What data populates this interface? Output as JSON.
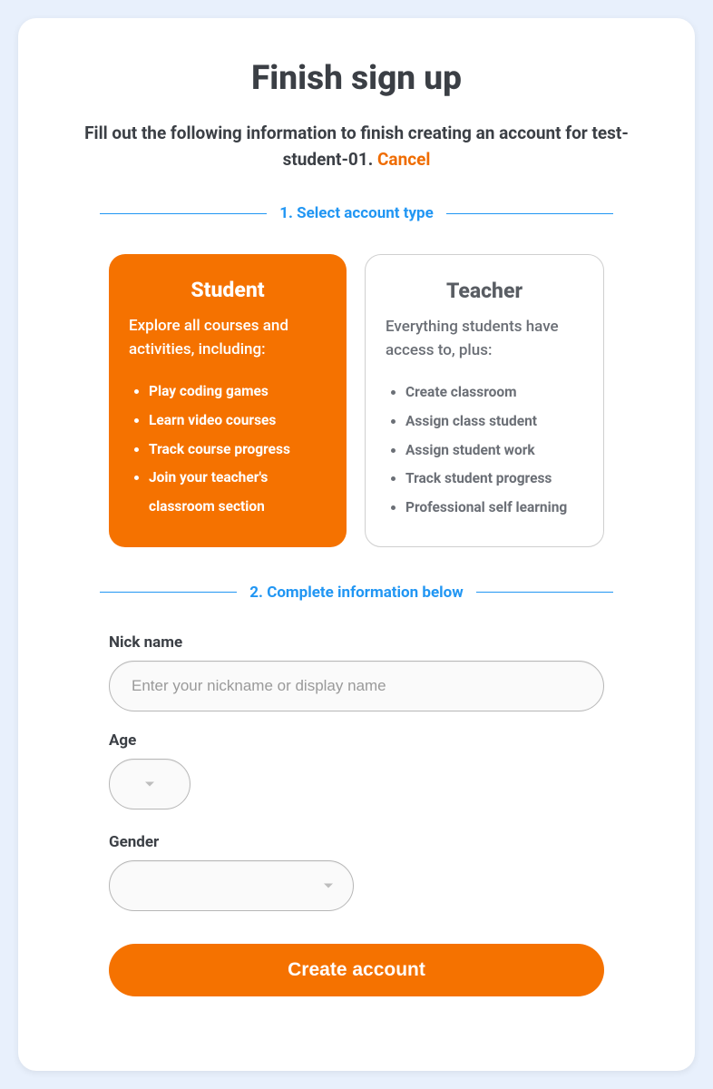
{
  "title": "Finish sign up",
  "subtitle_prefix": "Fill out the following information to finish creating an account for ",
  "username": "test-student-01.",
  "cancel_label": " Cancel",
  "section1_label": "1. Select account type",
  "section2_label": "2. Complete information below",
  "account_types": {
    "student": {
      "title": "Student",
      "desc": "Explore all courses and activities, including:",
      "items": [
        "Play coding games",
        "Learn video courses",
        "Track course progress",
        "Join your teacher's classroom section"
      ]
    },
    "teacher": {
      "title": "Teacher",
      "desc": "Everything students have access to, plus:",
      "items": [
        "Create classroom",
        "Assign class student",
        "Assign student work",
        "Track student progress",
        "Professional self learning"
      ]
    }
  },
  "form": {
    "nickname_label": "Nick name",
    "nickname_placeholder": "Enter your nickname or display name",
    "nickname_value": "",
    "age_label": "Age",
    "age_value": "",
    "gender_label": "Gender",
    "gender_value": ""
  },
  "submit_label": "Create account",
  "colors": {
    "accent_orange": "#f57200",
    "accent_blue": "#2196f3"
  }
}
